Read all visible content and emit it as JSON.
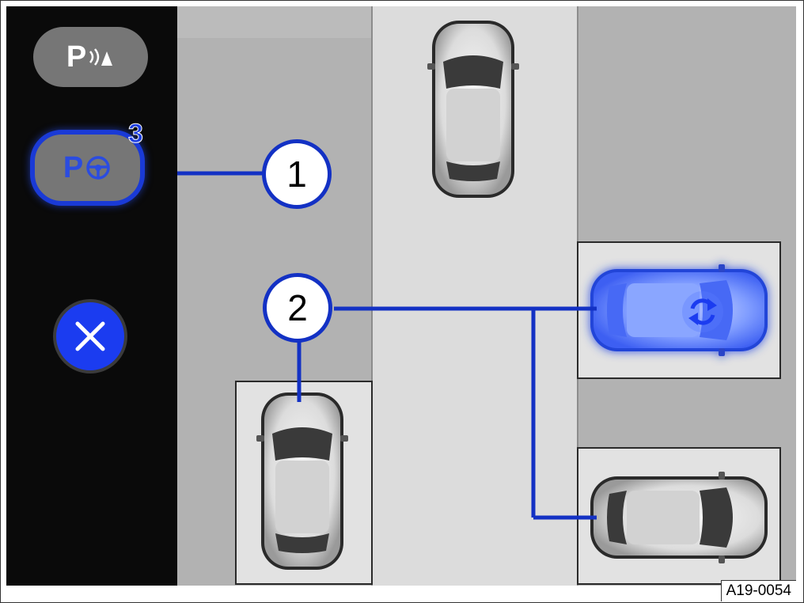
{
  "sidebar": {
    "buttons": [
      {
        "id": "sensor",
        "label": "P",
        "icon": "park-distance-sensor-icon"
      },
      {
        "id": "assist",
        "label": "P",
        "icon": "steering-wheel-icon",
        "badge": "3"
      },
      {
        "id": "cancel",
        "icon": "close-icon"
      }
    ]
  },
  "callouts": {
    "one": "1",
    "two": "2"
  },
  "figure_id": "A19-0054",
  "colors": {
    "accent_blue": "#1b3cf0",
    "callout_line": "#1331c4",
    "sidebar_bg": "#0a0a0a",
    "road": "#d8d8d8",
    "parking_area": "#b4b4b4",
    "parking_bay": "#e2e2e2",
    "highlighted_car": "#6a8cff"
  },
  "scene": {
    "cars": [
      {
        "id": "car-top",
        "state": "parked"
      },
      {
        "id": "car-bottom-left",
        "state": "parked"
      },
      {
        "id": "car-right-selected",
        "state": "selected",
        "icon": "rotate-arrows-icon"
      },
      {
        "id": "car-bottom-right",
        "state": "parked"
      }
    ]
  }
}
